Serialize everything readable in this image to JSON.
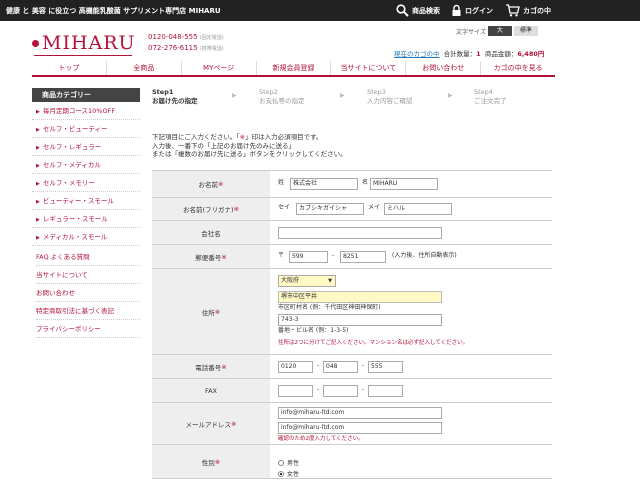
{
  "header": {
    "tagline": "健康 と 美容 に役立つ 高機能乳酸菌 サプリメント専門店 MIHARU",
    "search_label": "商品検索",
    "login_label": "ログイン",
    "cart_label": "カゴの中"
  },
  "logo": {
    "text": "MIHARU",
    "color": "#b5113a"
  },
  "contact": {
    "tel": "0120-048-555",
    "tel_note": "(固定電話)",
    "mobile": "072-276-6115",
    "mobile_note": "(携帯電話)"
  },
  "font_size": {
    "label": "文字サイズ",
    "large": "大",
    "standard": "標準"
  },
  "cart_info": {
    "link": "現在のカゴの中",
    "qty_label": "合計数量：",
    "qty": "1",
    "amount_label": "商品金額：",
    "amount": "6,480円"
  },
  "nav": {
    "items": [
      "トップ",
      "全商品",
      "MYページ",
      "新規会員登録",
      "当サイトについて",
      "お問い合わせ",
      "カゴの中を見る"
    ]
  },
  "sidebar": {
    "category_head": "商品カテゴリー",
    "categories": [
      "毎月定期コース10%OFF",
      "セルフ・ビューティー",
      "セルフ・レギュラー",
      "セルフ・メディカル",
      "セルフ・メモリー",
      "ビューティー・スモール",
      "レギュラー・スモール",
      "メディカル・スモール"
    ],
    "links": [
      "FAQ よくある質問",
      "当サイトについて",
      "お問い合わせ",
      "特定商取引法に基づく表記",
      "プライバシーポリシー"
    ]
  },
  "steps": [
    {
      "num": "Step1",
      "label": "お届け先の指定"
    },
    {
      "num": "Step2",
      "label": "お支払等の指定"
    },
    {
      "num": "Step3",
      "label": "入力内容ご確認"
    },
    {
      "num": "Step4",
      "label": "ご注文完了"
    }
  ],
  "instructions": {
    "line1_a": "下記項目にご入力ください。「",
    "line1_mark": "※",
    "line1_b": "」印は入力必須項目です。",
    "line2": "入力後、一番下の「上記のお届け先のみに送る」",
    "line3": "または「複数のお届け先に送る」ボタンをクリックしてください。"
  },
  "form": {
    "required_mark": "※",
    "name": {
      "label": "お名前",
      "sei_label": "姓",
      "sei": "株式会社",
      "mei_label": "名",
      "mei": "MIHARU"
    },
    "kana": {
      "label": "お名前(フリガナ)",
      "sei_label": "セイ",
      "sei": "カブシキガイシャ",
      "mei_label": "メイ",
      "mei": "ミハル"
    },
    "company": {
      "label": "会社名",
      "value": ""
    },
    "zip": {
      "label": "郵便番号",
      "mark": "〒",
      "zip1": "599",
      "zip2": "8251",
      "note": "(入力後、住所自動表示)"
    },
    "address": {
      "label": "住所",
      "pref": "大阪府",
      "city": "堺市中区平井",
      "city_hint": "市区町村名 (例：千代田区神田神保町)",
      "street": "743-3",
      "street_hint": "番地・ビル名 (例：1-3-5)",
      "note": "住所は2つに分けてご記入ください。マンション名は必ず記入してください。"
    },
    "tel": {
      "label": "電話番号",
      "tel1": "0120",
      "tel2": "048",
      "tel3": "555"
    },
    "fax": {
      "label": "FAX",
      "fax1": "",
      "fax2": "",
      "fax3": ""
    },
    "email": {
      "label": "メールアドレス",
      "value": "info@miharu-ltd.com",
      "confirm": "info@miharu-ltd.com",
      "note": "確認のため2度入力してください。"
    },
    "gender": {
      "label": "性別",
      "male": "男性",
      "female": "女性"
    }
  }
}
